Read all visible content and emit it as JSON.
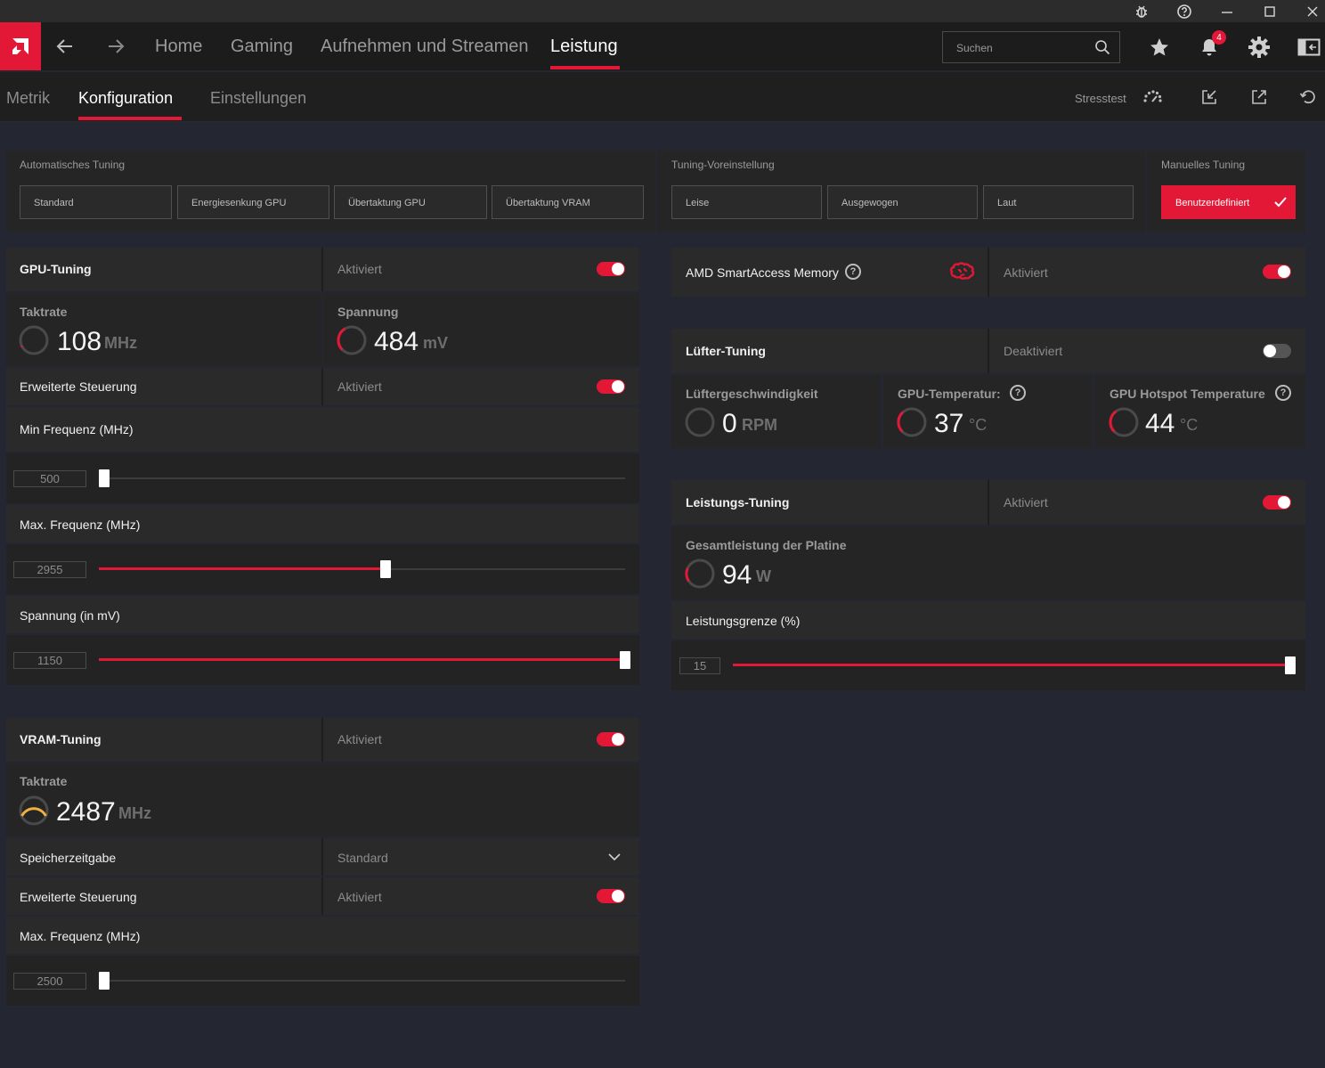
{
  "nav": {
    "items": [
      "Home",
      "Gaming",
      "Aufnehmen und Streamen",
      "Leistung"
    ],
    "search_placeholder": "Suchen",
    "notification_count": "4"
  },
  "subnav": {
    "tabs": [
      "Metrik",
      "Konfiguration",
      "Einstellungen"
    ],
    "stresstest": "Stresstest"
  },
  "presets": {
    "auto_label": "Automatisches Tuning",
    "auto_buttons": [
      "Standard",
      "Energiesenkung GPU",
      "Übertaktung GPU",
      "Übertaktung VRAM"
    ],
    "preset_label": "Tuning-Voreinstellung",
    "preset_buttons": [
      "Leise",
      "Ausgewogen",
      "Laut"
    ],
    "manual_label": "Manuelles Tuning",
    "manual_button": "Benutzerdefiniert"
  },
  "gpu": {
    "title": "GPU-Tuning",
    "state": "Aktiviert",
    "clock_label": "Taktrate",
    "clock_value": "108",
    "clock_unit": "MHz",
    "voltage_label": "Spannung",
    "voltage_value": "484",
    "voltage_unit": "mV",
    "advanced_label": "Erweiterte Steuerung",
    "advanced_state": "Aktiviert",
    "min_freq_label": "Min Frequenz (MHz)",
    "min_freq_value": "500",
    "min_freq_fraction": 0.0,
    "max_freq_label": "Max. Frequenz (MHz)",
    "max_freq_value": "2955",
    "max_freq_fraction": 0.54,
    "voltage_slider_label": "Spannung (in mV)",
    "voltage_slider_value": "1150",
    "voltage_slider_fraction": 1.0
  },
  "vram": {
    "title": "VRAM-Tuning",
    "state": "Aktiviert",
    "clock_label": "Taktrate",
    "clock_value": "2487",
    "clock_unit": "MHz",
    "timing_label": "Speicherzeitgabe",
    "timing_value": "Standard",
    "advanced_label": "Erweiterte Steuerung",
    "advanced_state": "Aktiviert",
    "max_freq_label": "Max. Frequenz (MHz)",
    "max_freq_value": "2500",
    "max_freq_fraction": 0.0
  },
  "sam": {
    "title": "AMD SmartAccess Memory",
    "state": "Aktiviert"
  },
  "fan": {
    "title": "Lüfter-Tuning",
    "state": "Deaktiviert",
    "speed_label": "Lüftergeschwindigkeit",
    "speed_value": "0",
    "speed_unit": "RPM",
    "temp_label": "GPU-Temperatur:",
    "temp_value": "37",
    "temp_unit": "°C",
    "hotspot_label": "GPU Hotspot Temperature",
    "hotspot_value": "44",
    "hotspot_unit": "°C"
  },
  "power": {
    "title": "Leistungs-Tuning",
    "state": "Aktiviert",
    "board_label": "Gesamtleistung der Platine",
    "board_value": "94",
    "board_unit": "W",
    "limit_label": "Leistungsgrenze (%)",
    "limit_value": "15",
    "limit_fraction": 1.0
  },
  "colors": {
    "accent": "#e31837",
    "gauge_vram": "#f0b040"
  }
}
